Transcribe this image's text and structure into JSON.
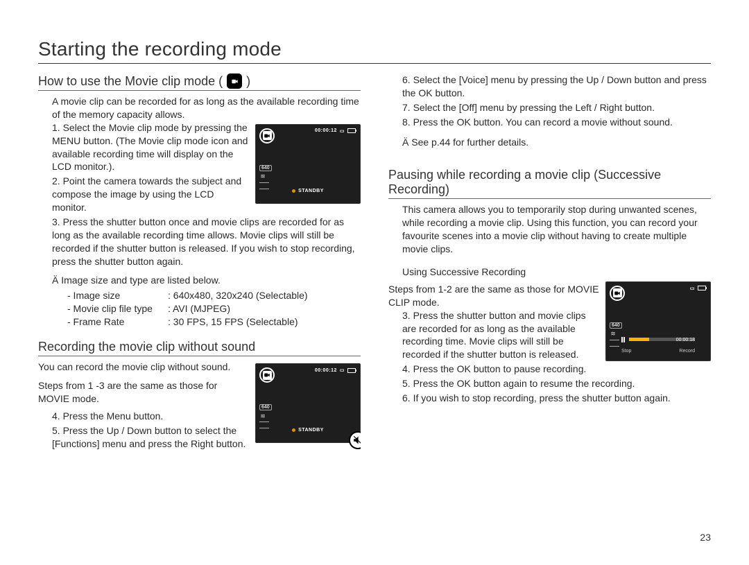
{
  "page_title": "Starting the recording mode",
  "page_number": "23",
  "left": {
    "sec1": {
      "heading_pre": "How to use the Movie clip mode (",
      "heading_post": ")",
      "intro": "A movie clip can be recorded for as long as the available recording time of the memory capacity allows.",
      "steps": {
        "s1": "1. Select the Movie clip mode by pressing the MENU button. (The Movie clip mode icon and available recording time will display on the LCD monitor.).",
        "s2": "2. Point the camera towards the subject and compose the image by using the LCD monitor.",
        "s3": "3. Press the shutter button once and movie clips are recorded for as long as the available recording time allows. Movie clips will still be recorded if the shutter button is released. If you wish to stop recording, press the shutter button again."
      },
      "note_intro": " Image size and type are listed below.",
      "specs": {
        "image_size_label": "- Image size",
        "image_size_val": ": 640x480, 320x240 (Selectable)",
        "file_type_label": "- Movie clip ﬁle type",
        "file_type_val": ": AVI (MJPEG)",
        "frame_rate_label": "- Frame Rate",
        "frame_rate_val": ": 30 FPS, 15 FPS (Selectable)"
      },
      "lcd": {
        "time": "00:00:12",
        "size": "640",
        "status": "STANDBY"
      }
    },
    "sec2": {
      "heading": "Recording the movie clip without sound",
      "intro": "You can record the movie clip without sound.",
      "lead": "Steps from 1 -3 are the same as those for MOVIE mode.",
      "s4": "4. Press the Menu button.",
      "s5": "5. Press the Up / Down button to select the [Functions] menu and press the Right button.",
      "lcd": {
        "time": "00:00:12",
        "size": "640",
        "status": "STANDBY"
      }
    }
  },
  "right": {
    "cont": {
      "s6": "6. Select the [Voice] menu by pressing the Up / Down button and press the OK button.",
      "s7": "7. Select the [Off] menu by pressing the Left / Right button.",
      "s8": "8. Press the OK button. You can record a movie without sound.",
      "note": " See p.44 for further details."
    },
    "sec3": {
      "heading": "Pausing while recording a movie clip (Successive Recording)",
      "intro": "This camera allows you to temporarily stop during unwanted scenes, while recording a movie clip. Using this function, you can record your favourite scenes into a movie clip without having to create multiple movie clips.",
      "sub": "Using Successive Recording",
      "lead": "Steps from 1-2 are the same as those for MOVIE CLIP mode.",
      "s3": "3. Press the shutter button and movie clips are recorded for as long as the available recording time. Movie clips will still be recorded if the shutter button is released.",
      "s4": "4. Press the OK button to pause recording.",
      "s5": "5. Press the OK button again to resume the recording.",
      "s6": "6. If you wish to stop recording, press the shutter button again.",
      "lcd": {
        "size": "640",
        "time": "00:00:18",
        "stop": "Stop",
        "record": "Record"
      }
    }
  }
}
